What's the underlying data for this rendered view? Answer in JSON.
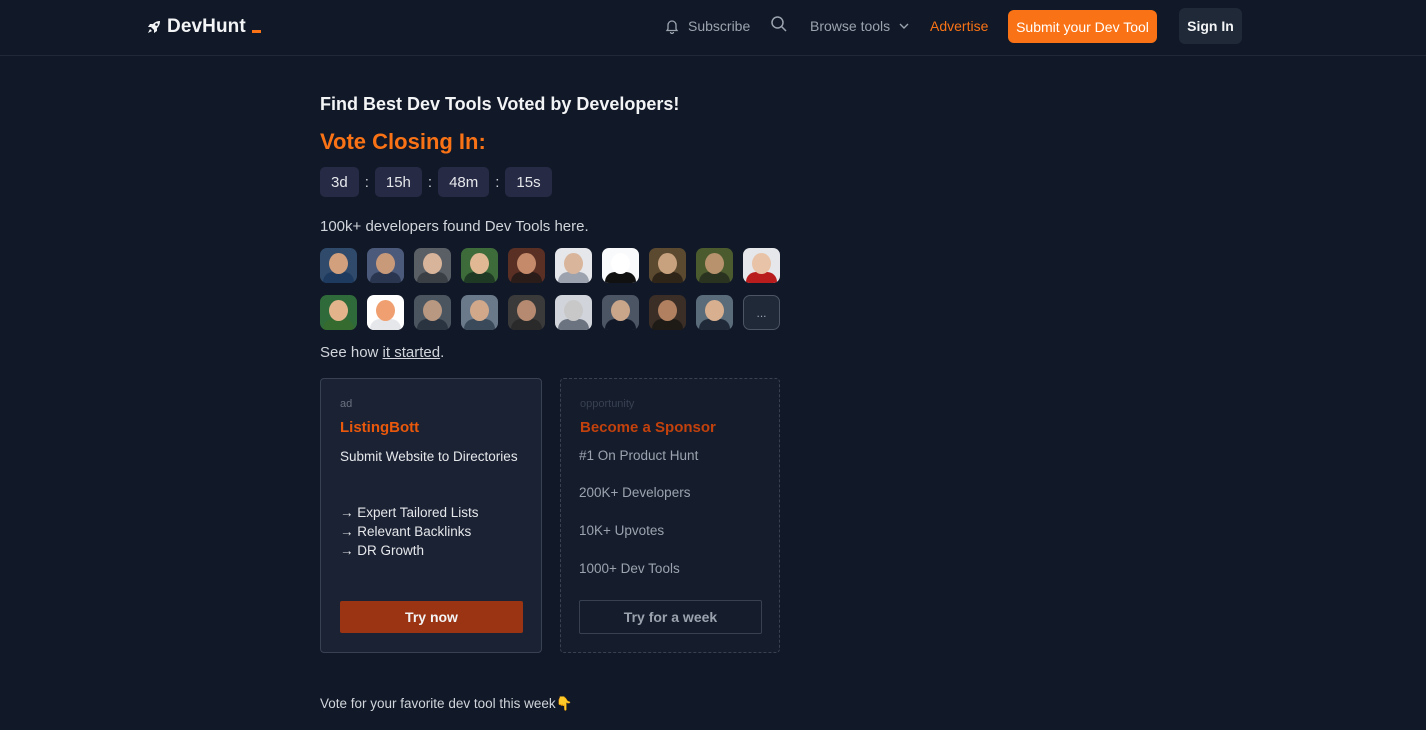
{
  "header": {
    "logo_text": "DevHunt",
    "subscribe_label": "Subscribe",
    "browse_label": "Browse tools",
    "advertise_label": "Advertise",
    "submit_label": "Submit your Dev Tool",
    "signin_label": "Sign In"
  },
  "hero": {
    "headline": "Find Best Dev Tools Voted by Developers!",
    "closing_label": "Vote Closing In:",
    "countdown": {
      "days": "3d",
      "hours": "15h",
      "minutes": "48m",
      "seconds": "15s",
      "separator": ":"
    },
    "found_text": "100k+ developers found Dev Tools here.",
    "more_avatars_label": "...",
    "seehow_prefix": "See how ",
    "seehow_link": "it started",
    "seehow_suffix": "."
  },
  "ad_card": {
    "tag": "ad",
    "title": "ListingBott",
    "description": "Submit Website to Directories",
    "points": [
      "→ Expert Tailored Lists",
      "→ Relevant Backlinks",
      "→ DR Growth"
    ],
    "button_label": "Try now"
  },
  "sponsor_card": {
    "tag": "opportunity",
    "title": "Become a Sponsor",
    "items": [
      "#1 On Product Hunt",
      "200K+ Developers",
      "10K+ Upvotes",
      "1000+ Dev Tools"
    ],
    "button_label": "Try for a week"
  },
  "footer": {
    "vote_text": "Vote for your favorite dev tool this week👇"
  },
  "colors": {
    "background": "#111827",
    "accent": "#f97316",
    "ad_button": "#9a3412"
  }
}
